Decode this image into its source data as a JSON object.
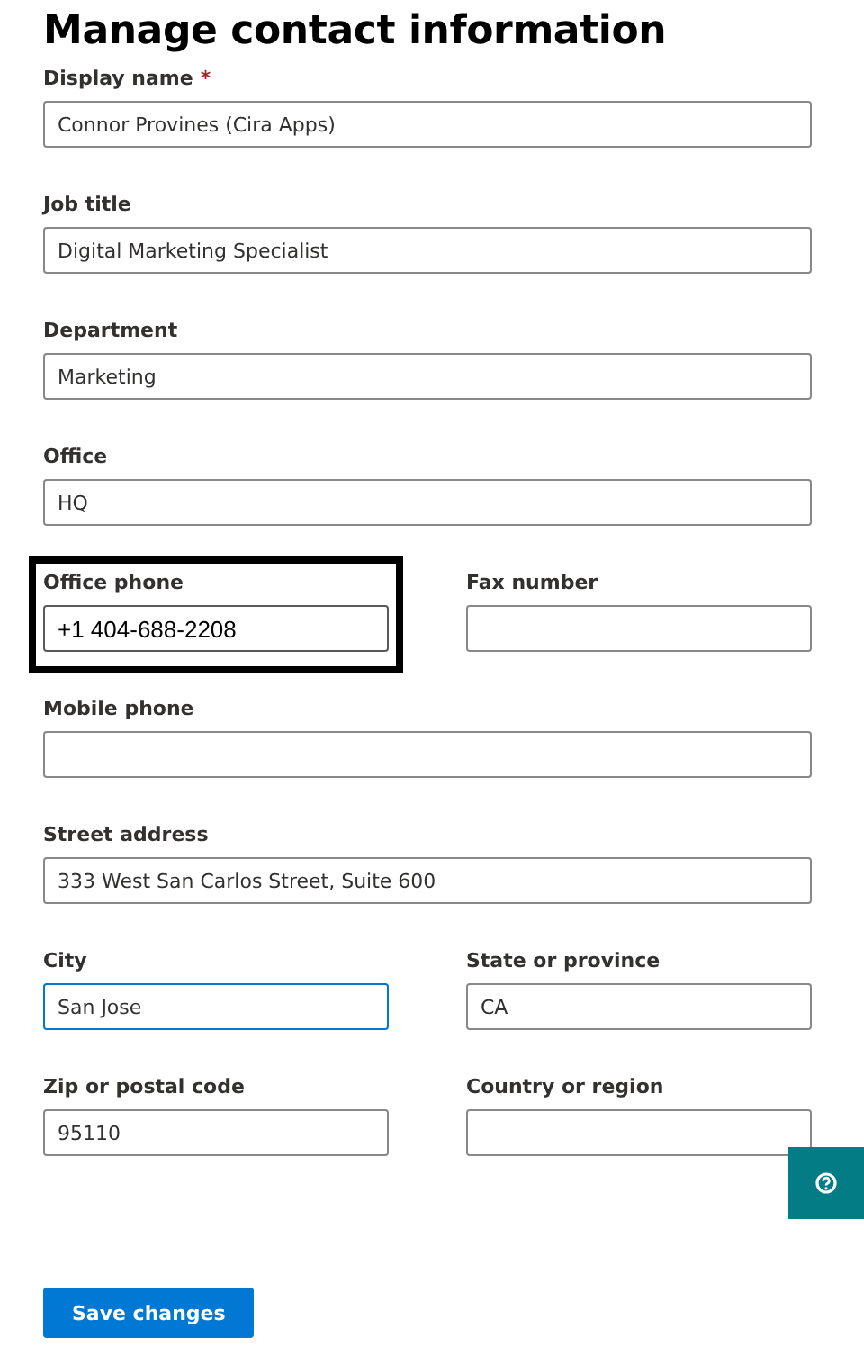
{
  "title": "Manage contact information",
  "rows": [
    {
      "fields": [
        {
          "label": "Display name",
          "required_mark": "*",
          "value": "Connor Provines (Cira Apps)",
          "focused": false,
          "highlighted": false
        }
      ]
    },
    {
      "fields": [
        {
          "label": "Job title",
          "value": "Digital Marketing Specialist",
          "focused": false,
          "highlighted": false
        }
      ]
    },
    {
      "fields": [
        {
          "label": "Department",
          "value": "Marketing",
          "focused": false,
          "highlighted": false
        }
      ]
    },
    {
      "fields": [
        {
          "label": "Office",
          "value": "HQ",
          "focused": false,
          "highlighted": false
        }
      ]
    },
    {
      "fields": [
        {
          "label": "Office phone",
          "value": "+1 404-688-2208",
          "focused": false,
          "highlighted": true
        },
        {
          "label": "Fax number",
          "focused": false,
          "highlighted": false
        }
      ]
    },
    {
      "fields": [
        {
          "label": "Mobile phone",
          "focused": false,
          "highlighted": false
        }
      ]
    },
    {
      "fields": [
        {
          "label": "Street address",
          "value": "333 West San Carlos Street, Suite 600",
          "focused": false,
          "highlighted": false
        }
      ]
    },
    {
      "fields": [
        {
          "label": "City",
          "value": "San Jose",
          "focused": true,
          "highlighted": false
        },
        {
          "label": "State or province",
          "value": "CA",
          "focused": false,
          "highlighted": false
        }
      ]
    },
    {
      "fields": [
        {
          "label": "Zip or postal code",
          "value": "95110",
          "focused": false,
          "highlighted": false
        },
        {
          "label": "Country or region",
          "focused": false,
          "highlighted": false
        }
      ]
    }
  ],
  "save_button": "Save changes"
}
